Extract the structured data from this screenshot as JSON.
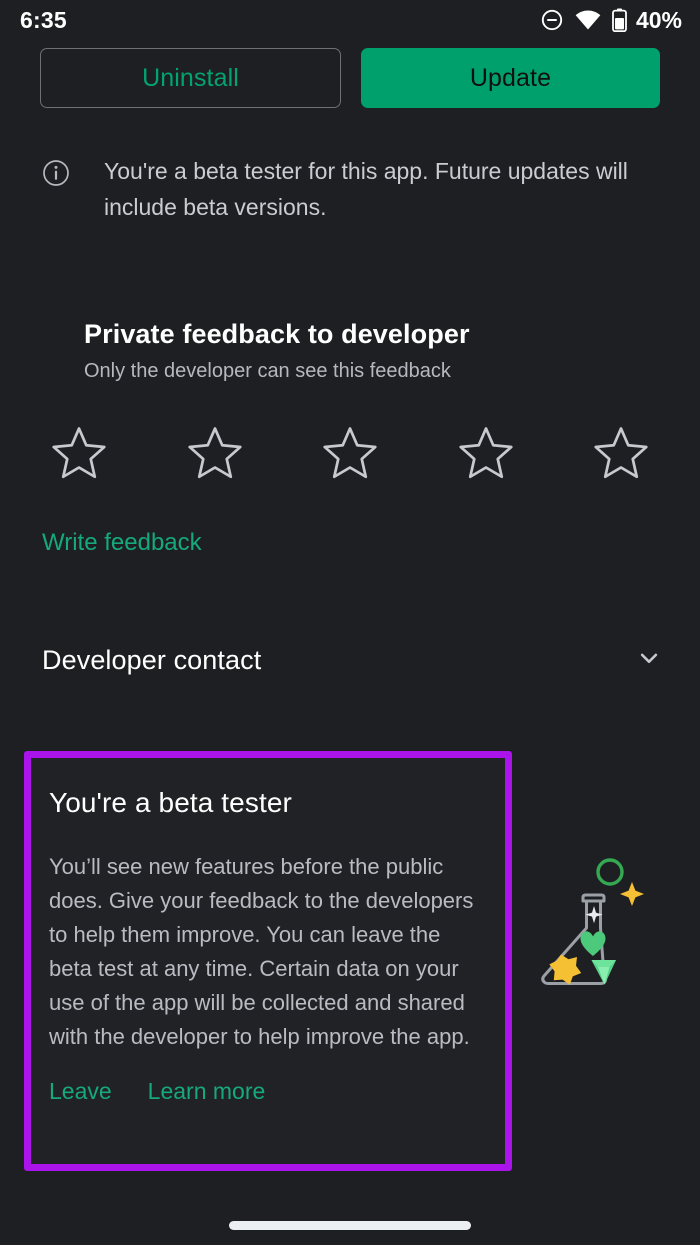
{
  "status_bar": {
    "time": "6:35",
    "battery_percent": "40%",
    "icons": [
      "do-not-disturb-icon",
      "wifi-icon",
      "battery-icon"
    ]
  },
  "actions": {
    "uninstall_label": "Uninstall",
    "update_label": "Update"
  },
  "beta_notice": {
    "icon": "info-icon",
    "text": "You're a beta tester for this app. Future updates will include beta versions."
  },
  "private_feedback": {
    "title": "Private feedback to developer",
    "subtitle": "Only the developer can see this feedback",
    "rating": 0,
    "max_rating": 5,
    "write_feedback_label": "Write feedback"
  },
  "developer_contact": {
    "label": "Developer contact",
    "expand_icon": "chevron-down-icon"
  },
  "beta_card": {
    "title": "You're a beta tester",
    "body": "You’ll see new features before the public does. Give your feedback to the developers to help them improve. You can leave the beta test at any time. Certain data on your use of the app will be collected and shared with the developer to help improve the app.",
    "leave_label": "Leave",
    "learn_more_label": "Learn more",
    "illustration": "beta-flask-illustration"
  },
  "colors": {
    "page_background": "#1e1f22",
    "card_background": "#212226",
    "accent_green": "#00a06c",
    "link_green": "#16a97a",
    "highlight_purple": "#aa13ea",
    "primary_text": "#ffffff",
    "secondary_text": "#b8bcc2",
    "flask_outline": "#9aa0a6",
    "heart_green": "#4cc97a",
    "star_gold": "#f5c033",
    "gem_green": "#6ee39b"
  }
}
